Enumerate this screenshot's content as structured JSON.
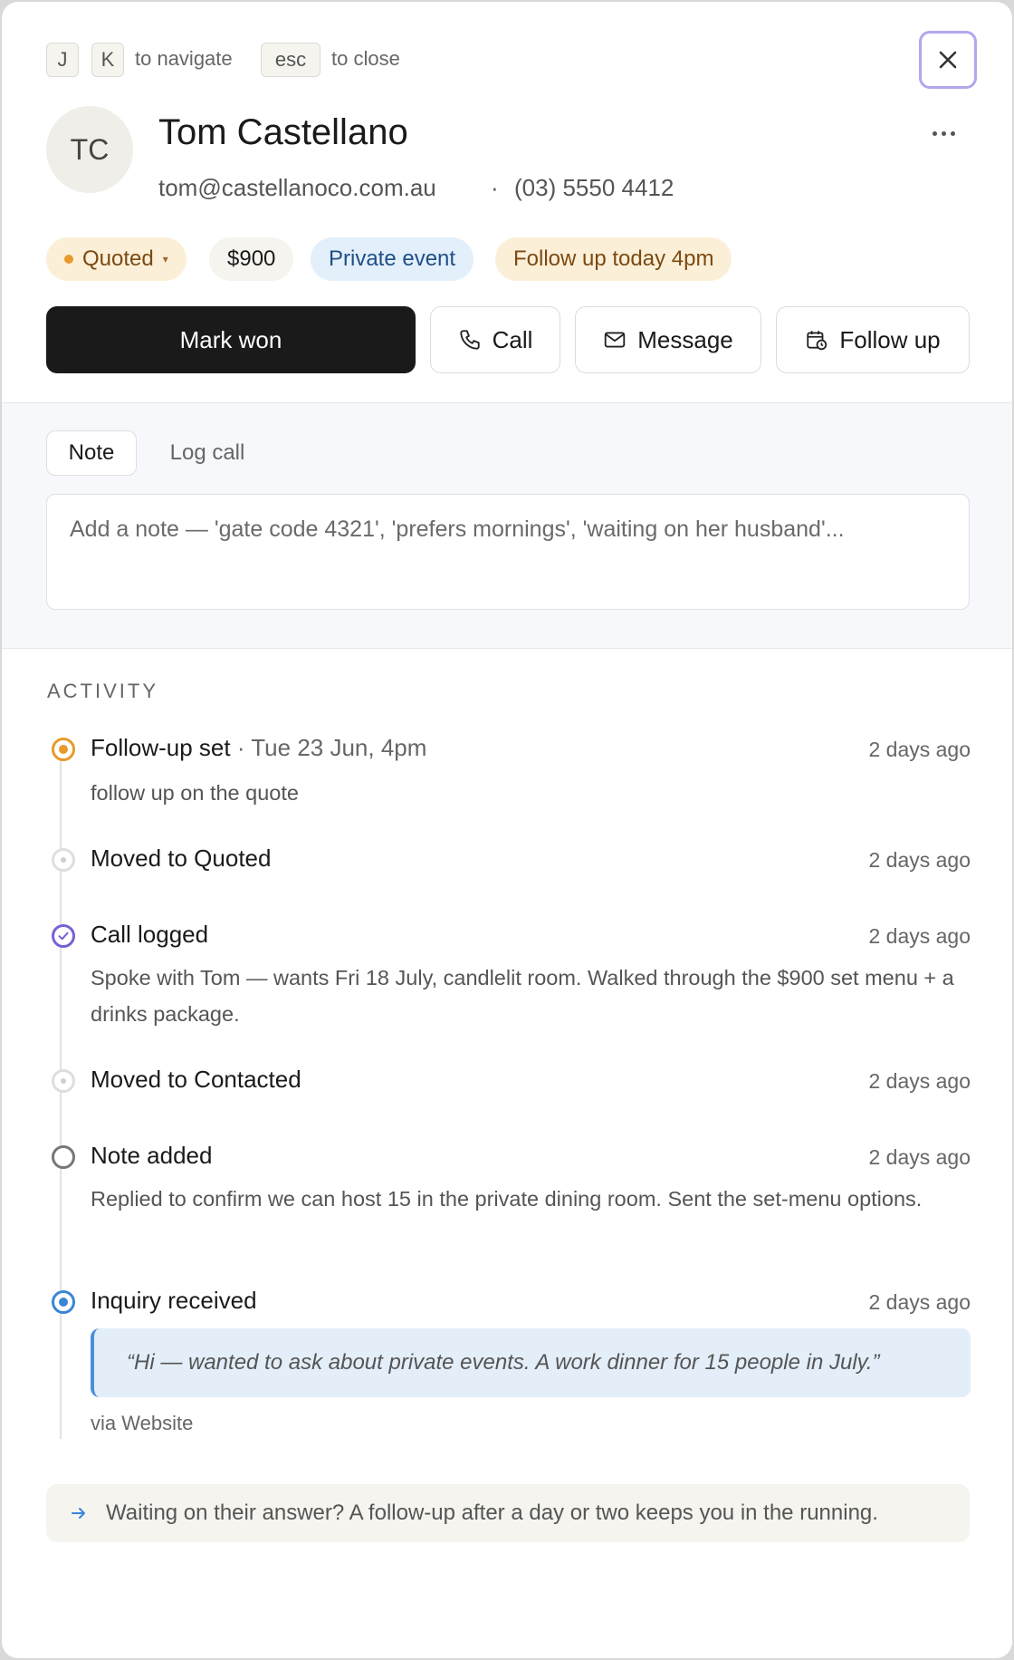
{
  "hints": {
    "key_j": "J",
    "key_k": "K",
    "navigate_text": "to navigate",
    "key_esc": "esc",
    "close_text": "to close"
  },
  "contact": {
    "initials": "TC",
    "name": "Tom Castellano",
    "email": "tom@castellanoco.com.au",
    "separator": "·",
    "phone": "(03) 5550 4412"
  },
  "chips": {
    "status": "Quoted",
    "amount": "$900",
    "category": "Private event",
    "followup": "Follow up today 4pm"
  },
  "actions": {
    "mark_won": "Mark won",
    "call": "Call",
    "message": "Message",
    "follow_up": "Follow up"
  },
  "composer": {
    "tabs": [
      "Note",
      "Log call"
    ],
    "placeholder": "Add a note — 'gate code 4321', 'prefers mornings', 'waiting on her husband'..."
  },
  "activity": {
    "title": "ACTIVITY",
    "items": [
      {
        "title": "Follow-up set",
        "sub": " · Tue 23 Jun, 4pm",
        "time": "2 days ago",
        "body": "follow up on the quote",
        "icon": "clock-target-icon"
      },
      {
        "title": "Moved to Quoted",
        "time": "2 days ago",
        "icon": "stage-dot-icon"
      },
      {
        "title": "Call logged",
        "time": "2 days ago",
        "body": "Spoke with Tom — wants Fri 18 July, candlelit room. Walked through the $900 set menu + a drinks package.",
        "icon": "check-circle-icon"
      },
      {
        "title": "Moved to Contacted",
        "time": "2 days ago",
        "icon": "stage-dot-icon"
      },
      {
        "title": "Note added",
        "time": "2 days ago",
        "body": "Replied to confirm we can host 15 in the private dining room. Sent the set-menu options.",
        "icon": "empty-circle-icon"
      },
      {
        "title": "Inquiry received",
        "time": "2 days ago",
        "quote": "“Hi — wanted to ask about private events. A work dinner for 15 people in July.”",
        "via": "via Website",
        "icon": "target-icon"
      }
    ]
  },
  "tip": {
    "text": "Waiting on their answer? A follow-up after a day or two keeps you in the running."
  },
  "colors": {
    "quoted_bg": "#fcefd8",
    "quoted_text": "#7a4a12",
    "private_bg": "#e3effa",
    "private_text": "#1f4f86",
    "accent_purple": "#7a5fd6",
    "accent_blue": "#3a86d6",
    "accent_orange": "#e89a2a"
  }
}
